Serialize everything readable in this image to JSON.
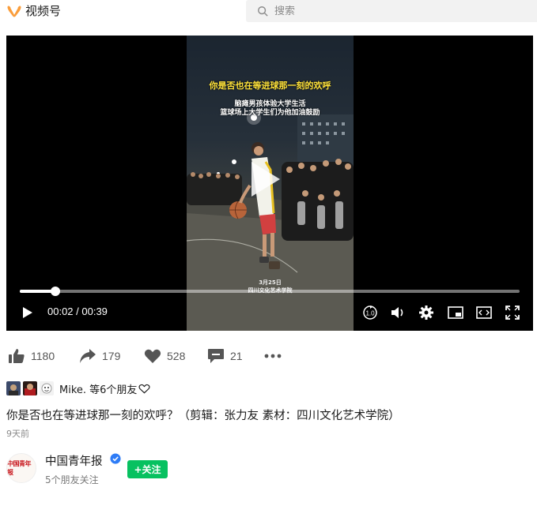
{
  "app": {
    "title": "视频号",
    "brand_color": "#fa9d3b"
  },
  "search": {
    "placeholder": "搜索",
    "value": ""
  },
  "video": {
    "overlay_title": "你是否也在等进球那一刻的欢呼",
    "overlay_line1": "脑瘫男孩体验大学生活",
    "overlay_line2": "篮球场上大学生们为他加油鼓励",
    "overlay_date": "3月25日",
    "overlay_place": "四川文化艺术学院",
    "time_display": "00:02 / 00:39",
    "progress": 0.071,
    "speed_label": "1.0"
  },
  "controls": {
    "icons": [
      "play-icon",
      "speed-icon",
      "volume-icon",
      "settings-icon",
      "pip-icon",
      "fullscreen-window-icon",
      "fullscreen-icon"
    ]
  },
  "actions": {
    "like": "1180",
    "share": "179",
    "favorite": "528",
    "comment": "21"
  },
  "friends": {
    "text": "Mike. 等6个朋友"
  },
  "post": {
    "caption": "你是否也在等进球那一刻的欢呼？（剪辑：张力友 素材：四川文化艺术学院）",
    "time_ago": "9天前"
  },
  "account": {
    "name": "中国青年报",
    "avatar_text": "中国青年报",
    "follow_label": "+关注",
    "sub": "5个朋友关注",
    "accent": "#07c160",
    "verified_color": "#2e7cf6"
  }
}
